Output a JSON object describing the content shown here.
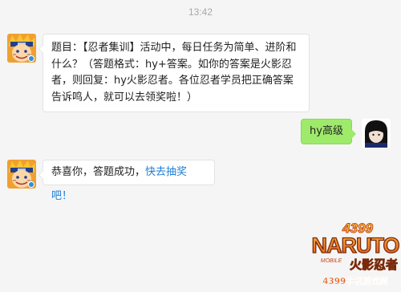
{
  "chat": {
    "timestamp": "13:42",
    "messages": [
      {
        "sender": "bot",
        "text": "题目：【忍者集训】活动中，每日任务为简单、进阶和什么？（答题格式：hy+答案。如你的答案是火影忍者，则回复：hy火影忍者。各位忍者学员把正确答案告诉鸣人，就可以去领奖啦！）"
      },
      {
        "sender": "user",
        "text": "hy高级"
      },
      {
        "sender": "bot",
        "text": "恭喜你，答题成功，",
        "link": "快去抽奖吧！"
      }
    ]
  },
  "watermark": {
    "number": "4399",
    "brand": "NARUTO",
    "chinese": "火影忍者",
    "subtitle": "4399手机游戏网",
    "mobile": "MOBILE"
  },
  "colors": {
    "background": "#f5f5f5",
    "bubble_bot": "#ffffff",
    "bubble_user": "#9eea6a",
    "link": "#1e7ed6"
  }
}
